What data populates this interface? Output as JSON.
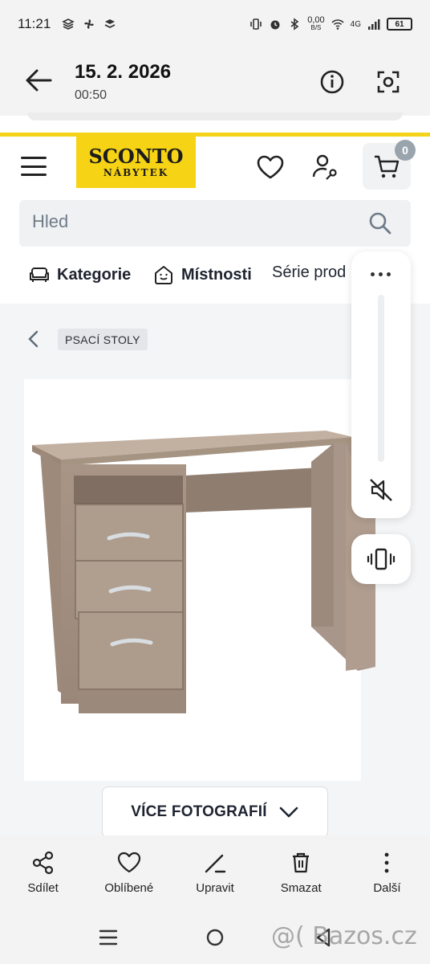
{
  "status_bar": {
    "time": "11:21",
    "network_speed_value": "0,00",
    "network_speed_unit": "B/S",
    "network_type": "4G",
    "battery": "61"
  },
  "viewer": {
    "date": "15. 2. 2026",
    "time": "00:50"
  },
  "site": {
    "logo_main": "SCONTO",
    "logo_sub": "NÁBYTEK",
    "cart_count": "0",
    "search_placeholder": "Hled",
    "nav": [
      {
        "label": "Kategorie",
        "icon": "sofa-icon"
      },
      {
        "label": "Místnosti",
        "icon": "house-icon"
      },
      {
        "label": "Série prod"
      }
    ],
    "breadcrumb": "PSACÍ STOLY",
    "more_photos": "VÍCE FOTOGRAFIÍ",
    "accent_color": "#f6d314"
  },
  "toolbar": {
    "items": [
      {
        "label": "Sdílet",
        "icon": "share-icon"
      },
      {
        "label": "Oblíbené",
        "icon": "heart-icon"
      },
      {
        "label": "Upravit",
        "icon": "edit-icon"
      },
      {
        "label": "Smazat",
        "icon": "trash-icon"
      },
      {
        "label": "Další",
        "icon": "more-vertical-icon"
      }
    ]
  },
  "watermark": "@( Bazos.cz"
}
